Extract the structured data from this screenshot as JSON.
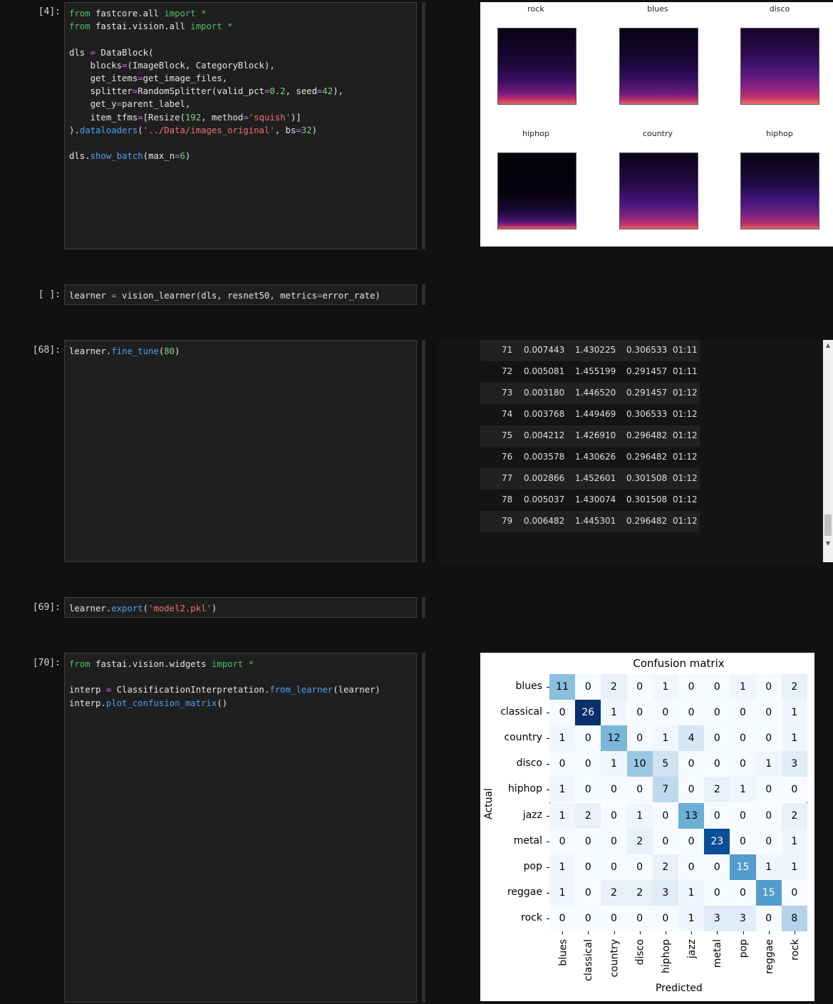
{
  "cells": [
    {
      "prompt": "[4]:",
      "code": [
        [
          [
            "kw",
            "from"
          ],
          [
            "t",
            " fastcore.all "
          ],
          [
            "kw",
            "import"
          ],
          [
            "kw",
            " *"
          ]
        ],
        [
          [
            "kw",
            "from"
          ],
          [
            "t",
            " fastai.vision.all "
          ],
          [
            "kw",
            "import"
          ],
          [
            "kw",
            " *"
          ]
        ],
        [
          [
            "t",
            ""
          ]
        ],
        [
          [
            "t",
            "dls "
          ],
          [
            "op",
            "="
          ],
          [
            "t",
            " DataBlock("
          ]
        ],
        [
          [
            "t",
            "    blocks"
          ],
          [
            "op",
            "="
          ],
          [
            "t",
            "(ImageBlock, CategoryBlock),"
          ]
        ],
        [
          [
            "t",
            "    get_items"
          ],
          [
            "op",
            "="
          ],
          [
            "t",
            "get_image_files,"
          ]
        ],
        [
          [
            "t",
            "    splitter"
          ],
          [
            "op",
            "="
          ],
          [
            "t",
            "RandomSplitter(valid_pct"
          ],
          [
            "op",
            "="
          ],
          [
            "num",
            "0.2"
          ],
          [
            "t",
            ", seed"
          ],
          [
            "op",
            "="
          ],
          [
            "num",
            "42"
          ],
          [
            "t",
            "),"
          ]
        ],
        [
          [
            "t",
            "    get_y"
          ],
          [
            "op",
            "="
          ],
          [
            "t",
            "parent_label,"
          ]
        ],
        [
          [
            "t",
            "    item_tfms"
          ],
          [
            "op",
            "="
          ],
          [
            "t",
            "[Resize("
          ],
          [
            "num",
            "192"
          ],
          [
            "t",
            ", method"
          ],
          [
            "op",
            "="
          ],
          [
            "str",
            "'squish'"
          ],
          [
            "t",
            ")]"
          ]
        ],
        [
          [
            "t",
            ")."
          ],
          [
            "fn",
            "dataloaders"
          ],
          [
            "t",
            "("
          ],
          [
            "str",
            "'../Data/images_original'"
          ],
          [
            "t",
            ", bs"
          ],
          [
            "op",
            "="
          ],
          [
            "num",
            "32"
          ],
          [
            "t",
            ")"
          ]
        ],
        [
          [
            "t",
            ""
          ]
        ],
        [
          [
            "t",
            "dls."
          ],
          [
            "fn",
            "show_batch"
          ],
          [
            "t",
            "(max_n"
          ],
          [
            "op",
            "="
          ],
          [
            "num",
            "6"
          ],
          [
            "t",
            ")"
          ]
        ]
      ]
    },
    {
      "prompt": "[ ]:",
      "code": [
        [
          [
            "t",
            "learner "
          ],
          [
            "op",
            "="
          ],
          [
            "t",
            " vision_learner(dls, resnet50, metrics"
          ],
          [
            "op",
            "="
          ],
          [
            "t",
            "error_rate)"
          ]
        ]
      ]
    },
    {
      "prompt": "[68]:",
      "code": [
        [
          [
            "t",
            "learner."
          ],
          [
            "fn",
            "fine_tune"
          ],
          [
            "t",
            "("
          ],
          [
            "num",
            "80"
          ],
          [
            "t",
            ")"
          ]
        ]
      ]
    },
    {
      "prompt": "[69]:",
      "code": [
        [
          [
            "t",
            "learner."
          ],
          [
            "fn",
            "export"
          ],
          [
            "t",
            "("
          ],
          [
            "str",
            "'model2.pkl'"
          ],
          [
            "t",
            ")"
          ]
        ]
      ]
    },
    {
      "prompt": "[70]:",
      "code": [
        [
          [
            "kw",
            "from"
          ],
          [
            "t",
            " fastai.vision.widgets "
          ],
          [
            "kw",
            "import"
          ],
          [
            "kw",
            " *"
          ]
        ],
        [
          [
            "t",
            ""
          ]
        ],
        [
          [
            "t",
            "interp "
          ],
          [
            "op",
            "="
          ],
          [
            "t",
            " ClassificationInterpretation."
          ],
          [
            "fn",
            "from_learner"
          ],
          [
            "t",
            "(learner)"
          ]
        ],
        [
          [
            "t",
            "interp."
          ],
          [
            "fn",
            "plot_confusion_matrix"
          ],
          [
            "t",
            "()"
          ]
        ]
      ]
    }
  ],
  "batch_labels": [
    "rock",
    "blues",
    "disco",
    "hiphop",
    "country",
    "hiphop"
  ],
  "training_rows": [
    [
      "71",
      "0.007443",
      "1.430225",
      "0.306533",
      "01:11"
    ],
    [
      "72",
      "0.005081",
      "1.455199",
      "0.291457",
      "01:11"
    ],
    [
      "73",
      "0.003180",
      "1.446520",
      "0.291457",
      "01:12"
    ],
    [
      "74",
      "0.003768",
      "1.449469",
      "0.306533",
      "01:12"
    ],
    [
      "75",
      "0.004212",
      "1.426910",
      "0.296482",
      "01:12"
    ],
    [
      "76",
      "0.003578",
      "1.430626",
      "0.296482",
      "01:12"
    ],
    [
      "77",
      "0.002866",
      "1.452601",
      "0.301508",
      "01:12"
    ],
    [
      "78",
      "0.005037",
      "1.430074",
      "0.301508",
      "01:12"
    ],
    [
      "79",
      "0.006482",
      "1.445301",
      "0.296482",
      "01:12"
    ]
  ],
  "chart_data": {
    "type": "heatmap",
    "title": "Confusion matrix",
    "xlabel": "Predicted",
    "ylabel": "Actual",
    "labels": [
      "blues",
      "classical",
      "country",
      "disco",
      "hiphop",
      "jazz",
      "metal",
      "pop",
      "reggae",
      "rock"
    ],
    "matrix": [
      [
        11,
        0,
        2,
        0,
        1,
        0,
        0,
        1,
        0,
        2
      ],
      [
        0,
        26,
        1,
        0,
        0,
        0,
        0,
        0,
        0,
        1
      ],
      [
        1,
        0,
        12,
        0,
        1,
        4,
        0,
        0,
        0,
        1
      ],
      [
        0,
        0,
        1,
        10,
        5,
        0,
        0,
        0,
        1,
        3
      ],
      [
        1,
        0,
        0,
        0,
        7,
        0,
        2,
        1,
        0,
        0
      ],
      [
        1,
        2,
        0,
        1,
        0,
        13,
        0,
        0,
        0,
        2
      ],
      [
        0,
        0,
        0,
        2,
        0,
        0,
        23,
        0,
        0,
        1
      ],
      [
        1,
        0,
        0,
        0,
        2,
        0,
        0,
        15,
        1,
        1
      ],
      [
        1,
        0,
        2,
        2,
        3,
        1,
        0,
        0,
        15,
        0
      ],
      [
        0,
        0,
        0,
        0,
        0,
        1,
        3,
        3,
        0,
        8
      ]
    ],
    "colormap": "Blues",
    "vmin": 0,
    "vmax": 26
  }
}
